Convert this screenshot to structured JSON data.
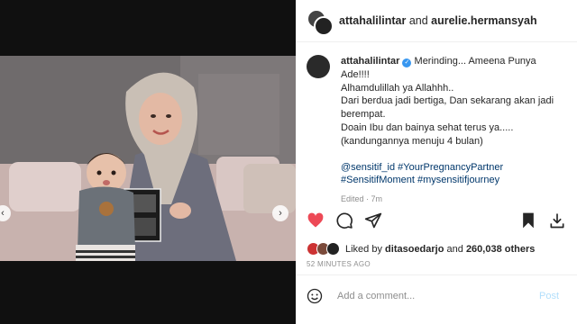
{
  "header": {
    "user1": "attahalilintar",
    "and": "and",
    "user2": "aurelie.hermansyah"
  },
  "caption": {
    "username": "attahalilintar",
    "lines": [
      "Merinding... Ameena Punya",
      "Ade!!!!",
      "Alhamdulillah ya Allahhh..",
      "Dari berdua jadi bertiga, Dan sekarang akan jadi",
      "berempat.",
      "Doain Ibu dan bainya sehat terus ya.....",
      "(kandungannya menuju 4 bulan)"
    ],
    "tags": [
      "@sensitif_id #YourPregnancyPartner",
      "#SensitifMoment #mysensitifjourney"
    ],
    "edited": "Edited · 7m"
  },
  "likes": {
    "prefix": "Liked by",
    "user": "ditasoedarjo",
    "and": "and",
    "count": "260,038 others"
  },
  "time": "52 MINUTES AGO",
  "comment": {
    "placeholder": "Add a comment...",
    "post_label": "Post"
  },
  "carousel": {
    "slides": 7,
    "active": 1
  },
  "icons": {
    "heart": "heart-icon",
    "comment": "comment-icon",
    "share": "share-icon",
    "save": "bookmark-icon",
    "emoji": "emoji-icon"
  },
  "colors": {
    "like": "#ed4956",
    "link": "#00376b",
    "accent": "#3897f0",
    "post": "#b2dffc"
  }
}
